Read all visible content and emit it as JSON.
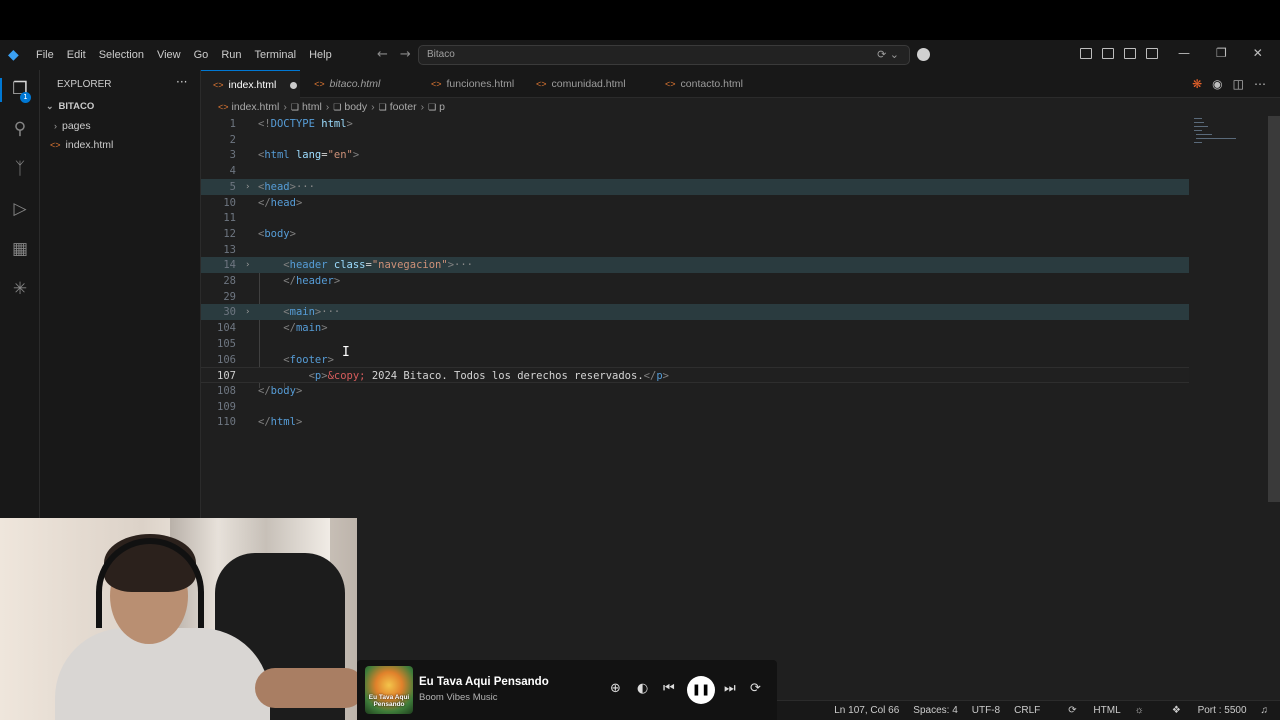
{
  "titlebar": {
    "menu": [
      "File",
      "Edit",
      "Selection",
      "View",
      "Go",
      "Run",
      "Terminal",
      "Help"
    ],
    "search": "Bitaco"
  },
  "activity": {
    "explorer_badge": "1"
  },
  "explorer": {
    "title": "EXPLORER",
    "more": "···",
    "folder": "BITACO",
    "items": [
      "pages",
      "index.html"
    ]
  },
  "tabs": [
    {
      "label": "index.html",
      "active": true,
      "modified": true
    },
    {
      "label": "bitaco.html",
      "italic": true
    },
    {
      "label": "funciones.html"
    },
    {
      "label": "comunidad.html"
    },
    {
      "label": "contacto.html"
    }
  ],
  "breadcrumb": [
    "index.html",
    "html",
    "body",
    "footer",
    "p"
  ],
  "editor": {
    "lines": [
      {
        "n": "1",
        "html": "<span class='tg'>&lt;!</span><span class='tn'>DOCTYPE</span> <span class='an'>html</span><span class='tg'>&gt;</span>"
      },
      {
        "n": "2",
        "html": ""
      },
      {
        "n": "3",
        "html": "<span class='tg'>&lt;</span><span class='tn'>html</span> <span class='an'>lang</span><span class='tx'>=</span><span class='av'>\"en\"</span><span class='tg'>&gt;</span>"
      },
      {
        "n": "4",
        "html": ""
      },
      {
        "n": "5",
        "html": "<span class='tg'>&lt;</span><span class='tn'>head</span><span class='tg'>&gt;</span><span class='ell'>···</span>",
        "fold": true,
        "hl": true
      },
      {
        "n": "10",
        "html": "<span class='tg'>&lt;/</span><span class='tn'>head</span><span class='tg'>&gt;</span>"
      },
      {
        "n": "11",
        "html": ""
      },
      {
        "n": "12",
        "html": "<span class='tg'>&lt;</span><span class='tn'>body</span><span class='tg'>&gt;</span>"
      },
      {
        "n": "13",
        "html": ""
      },
      {
        "n": "14",
        "html": "    <span class='tg'>&lt;</span><span class='tn'>header</span> <span class='an'>class</span><span class='tx'>=</span><span class='av'>\"navegacion\"</span><span class='tg'>&gt;</span><span class='ell'>···</span>",
        "fold": true,
        "hl": true
      },
      {
        "n": "28",
        "html": "    <span class='tg'>&lt;/</span><span class='tn'>header</span><span class='tg'>&gt;</span>"
      },
      {
        "n": "29",
        "html": ""
      },
      {
        "n": "30",
        "html": "    <span class='tg'>&lt;</span><span class='tn'>main</span><span class='tg'>&gt;</span><span class='ell'>···</span>",
        "fold": true,
        "hl": true
      },
      {
        "n": "104",
        "html": "    <span class='tg'>&lt;/</span><span class='tn'>main</span><span class='tg'>&gt;</span>"
      },
      {
        "n": "105",
        "html": ""
      },
      {
        "n": "106",
        "html": "    <span class='tg'>&lt;</span><span class='tn'>footer</span><span class='tg'>&gt;</span>"
      },
      {
        "n": "107",
        "html": "        <span class='tg'>&lt;</span><span class='tn'>p</span><span class='tg'>&gt;</span><span class='ent'>&amp;copy;</span><span class='tx'> 2024 Bitaco. Todos los derechos reservados.</span><span class='tg'>&lt;/</span><span class='tn'>p</span><span class='tg'>&gt;</span>",
        "cur": true
      },
      {
        "n": "108",
        "html": "<span class='tg'>&lt;/</span><span class='tn'>body</span><span class='tg'>&gt;</span>"
      },
      {
        "n": "109",
        "html": ""
      },
      {
        "n": "110",
        "html": "<span class='tg'>&lt;/</span><span class='tn'>html</span><span class='tg'>&gt;</span>"
      }
    ]
  },
  "status": {
    "position": "Ln 107, Col 66",
    "spaces": "Spaces: 4",
    "encoding": "UTF-8",
    "eol": "CRLF",
    "language": "HTML",
    "port": "Port : 5500"
  },
  "player": {
    "song": "Eu Tava Aqui Pensando",
    "artist": "Boom Vibes Music",
    "cover_text": "Eu Tava Aqui Pensando"
  }
}
